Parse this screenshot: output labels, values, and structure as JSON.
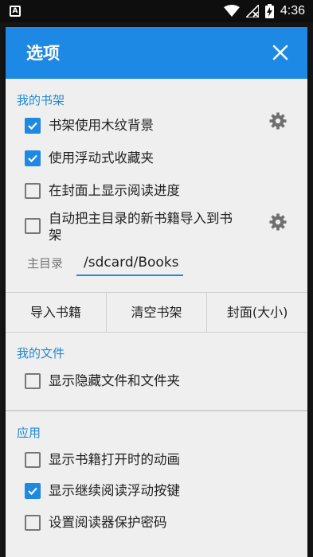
{
  "status_bar": {
    "time": "4:36"
  },
  "dialog": {
    "title": "选项",
    "sections": [
      {
        "title": "我的书架",
        "items": [
          {
            "label": "书架使用木纹背景",
            "checked": true,
            "has_settings": true
          },
          {
            "label": "使用浮动式收藏夹",
            "checked": true,
            "has_settings": false
          },
          {
            "label": "在封面上显示阅读进度",
            "checked": false,
            "has_settings": false
          },
          {
            "label_line1": "自动把主目录的新书籍导入到书",
            "label_line2": "架",
            "checked": false,
            "has_settings": true
          }
        ],
        "home_dir": {
          "label": "主目录",
          "value": "/sdcard/Books"
        },
        "buttons": [
          "导入书籍",
          "清空书架",
          "封面(大小)"
        ]
      },
      {
        "title": "我的文件",
        "items": [
          {
            "label": "显示隐藏文件和文件夹",
            "checked": false
          }
        ]
      },
      {
        "title": "应用",
        "items": [
          {
            "label": "显示书籍打开时的动画",
            "checked": false
          },
          {
            "label": "显示继续阅读浮动按键",
            "checked": true
          },
          {
            "label": "设置阅读器保护密码",
            "checked": false
          }
        ]
      }
    ]
  },
  "colors": {
    "accent": "#1e88e5",
    "section_title": "#2188d8",
    "dialog_bg": "#efefef"
  }
}
